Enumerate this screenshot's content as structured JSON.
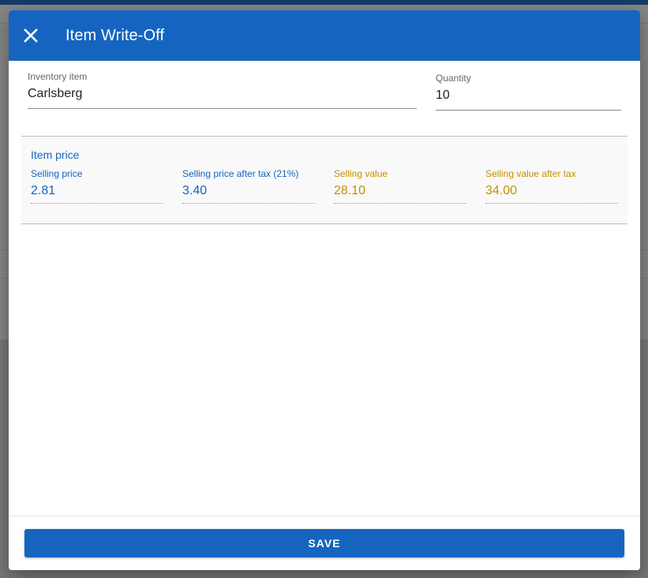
{
  "dialog": {
    "title": "Item Write-Off",
    "close_icon": "close-icon",
    "header_color": "#1565c0"
  },
  "form": {
    "inventory_item": {
      "label": "Inventory item",
      "value": "Carlsberg"
    },
    "quantity": {
      "label": "Quantity",
      "value": "10"
    }
  },
  "item_price": {
    "title": "Item price",
    "fields": [
      {
        "label": "Selling price",
        "value": "2.81",
        "color": "#1565c0"
      },
      {
        "label": "Selling price after tax (21%)",
        "value": "3.40",
        "color": "#1565c0"
      },
      {
        "label": "Selling value",
        "value": "28.10",
        "color": "#c49000"
      },
      {
        "label": "Selling value after tax",
        "value": "34.00",
        "color": "#c49000"
      }
    ]
  },
  "footer": {
    "save_label": "SAVE"
  }
}
